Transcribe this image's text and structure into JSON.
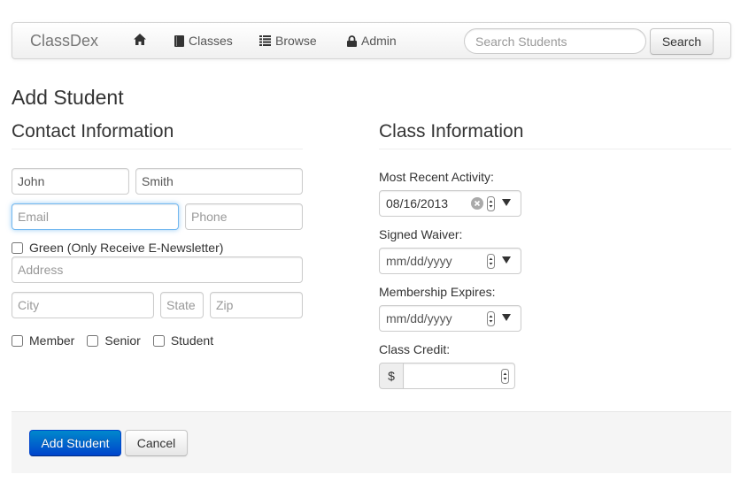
{
  "navbar": {
    "brand": "ClassDex",
    "items": [
      {
        "label": "",
        "icon": "home-icon"
      },
      {
        "label": "Classes",
        "icon": "book-icon"
      },
      {
        "label": "Browse",
        "icon": "list-icon"
      },
      {
        "label": "Admin",
        "icon": "lock-icon"
      }
    ],
    "search_placeholder": "Search Students",
    "search_button": "Search"
  },
  "page_title": "Add Student",
  "contact": {
    "title": "Contact Information",
    "first_name": {
      "value": "John"
    },
    "last_name": {
      "value": "Smith"
    },
    "email": {
      "placeholder": "Email"
    },
    "phone": {
      "placeholder": "Phone"
    },
    "green_label": "Green (Only Receive E-Newsletter)",
    "address": {
      "placeholder": "Address"
    },
    "city": {
      "placeholder": "City"
    },
    "state": {
      "placeholder": "State"
    },
    "zip": {
      "placeholder": "Zip"
    },
    "types": [
      "Member",
      "Senior",
      "Student"
    ]
  },
  "class_info": {
    "title": "Class Information",
    "recent_activity": {
      "label": "Most Recent Activity:",
      "value": "08/16/2013"
    },
    "signed_waiver": {
      "label": "Signed Waiver:",
      "placeholder": "mm/dd/yyyy"
    },
    "membership_expires": {
      "label": "Membership Expires:",
      "placeholder": "mm/dd/yyyy"
    },
    "class_credit": {
      "label": "Class Credit:",
      "addon": "$",
      "value": ""
    }
  },
  "actions": {
    "submit": "Add Student",
    "cancel": "Cancel"
  },
  "colors": {
    "primary": "#0055cc",
    "focus": "#52a8ec",
    "actions_bg": "#f5f5f5"
  }
}
